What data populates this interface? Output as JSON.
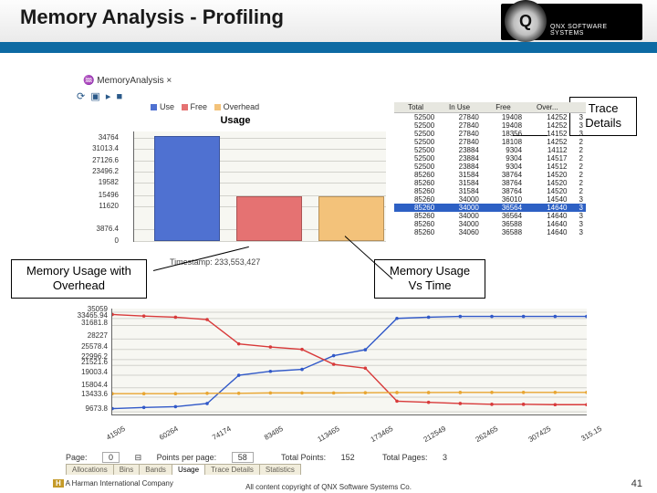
{
  "header": {
    "title": "Memory Analysis - Profiling",
    "brand_sub": "QNX SOFTWARE SYSTEMS"
  },
  "tab": "MemoryAnalysis ×",
  "legend_usage": [
    {
      "name": "Use",
      "color": "#4f71d1"
    },
    {
      "name": "Free",
      "color": "#e57272"
    },
    {
      "name": "Overhead",
      "color": "#f3c27a"
    }
  ],
  "annotations": {
    "trace": "Trace\nDetails",
    "over": "Memory Usage with\nOverhead",
    "time": "Memory Usage\nVs Time"
  },
  "chart_data": [
    {
      "type": "bar",
      "title": "Usage",
      "categories": [
        "Use",
        "Free",
        "Overhead"
      ],
      "values": [
        35000,
        14500,
        14500
      ],
      "ylim": [
        0,
        37000
      ],
      "yticks": [
        0,
        3876.4,
        11620,
        15496,
        19582,
        23496.2,
        27126.6,
        31013.4,
        34764
      ],
      "x_axis_note": "Timestamp: 233,553,427",
      "colors": [
        "#4f71d1",
        "#e57272",
        "#f3c27a"
      ]
    },
    {
      "type": "table",
      "title": "Trace Details",
      "columns": [
        "Total",
        "In Use",
        "Free",
        "Over..."
      ],
      "rows": [
        [
          52500,
          27840,
          19408,
          14252,
          3
        ],
        [
          52500,
          27840,
          19408,
          14252,
          3
        ],
        [
          52500,
          27840,
          18356,
          14152,
          3
        ],
        [
          52500,
          27840,
          18108,
          14252,
          2
        ],
        [
          52500,
          23884,
          9304,
          14112,
          2
        ],
        [
          52500,
          23884,
          9304,
          14517,
          2
        ],
        [
          52500,
          23884,
          9304,
          14512,
          2
        ],
        [
          85260,
          31584,
          38764,
          14520,
          2
        ],
        [
          85260,
          31584,
          38764,
          14520,
          2
        ],
        [
          85260,
          31584,
          38764,
          14520,
          2
        ],
        [
          85260,
          34000,
          36010,
          14540,
          3
        ],
        [
          85260,
          34000,
          36564,
          14640,
          3
        ],
        [
          85260,
          34000,
          36564,
          14640,
          3
        ],
        [
          85260,
          34000,
          36588,
          14640,
          3
        ],
        [
          85260,
          34060,
          36588,
          14640,
          3
        ]
      ],
      "selected_row": 11
    },
    {
      "type": "line",
      "title": "Memory Usage Vs Time",
      "x": [
        41505,
        60264,
        74174,
        83485,
        113465,
        173465,
        212549,
        262465,
        307425,
        315.15
      ],
      "yticks": [
        9673.8,
        13433.6,
        15804.4,
        19003.4,
        21521.6,
        22996.2,
        25578.4,
        28227,
        31681.8,
        33465.94,
        35059
      ],
      "ylim": [
        9000,
        36000
      ],
      "series": [
        {
          "name": "use",
          "color": "#3159c8",
          "values": [
            10500,
            10800,
            11000,
            11800,
            19000,
            20000,
            20500,
            24000,
            25500,
            33500,
            33800,
            34000,
            34000,
            34000,
            34000,
            34000
          ]
        },
        {
          "name": "free",
          "color": "#d83a3a",
          "values": [
            34500,
            34100,
            33800,
            33200,
            27000,
            26200,
            25600,
            21800,
            20800,
            12400,
            12100,
            11800,
            11600,
            11600,
            11500,
            11500
          ]
        },
        {
          "name": "overhead",
          "color": "#e8a531",
          "values": [
            14300,
            14300,
            14300,
            14400,
            14400,
            14500,
            14500,
            14500,
            14550,
            14600,
            14600,
            14620,
            14640,
            14640,
            14640,
            14640
          ]
        }
      ]
    }
  ],
  "pager": {
    "page_label": "Page:",
    "page": "0",
    "ppp_label": "Points per page:",
    "ppp": "58",
    "total_points_label": "Total Points:",
    "total_points": "152",
    "total_pages_label": "Total Pages:",
    "total_pages": "3"
  },
  "bottom_tabs": [
    "Allocations",
    "Bins",
    "Bands",
    "Usage",
    "Trace Details",
    "Statistics"
  ],
  "bottom_tabs_active": 3,
  "harman": "A Harman International Company",
  "footer": "All content copyright of QNX Software Systems Co.",
  "page_number": "41"
}
